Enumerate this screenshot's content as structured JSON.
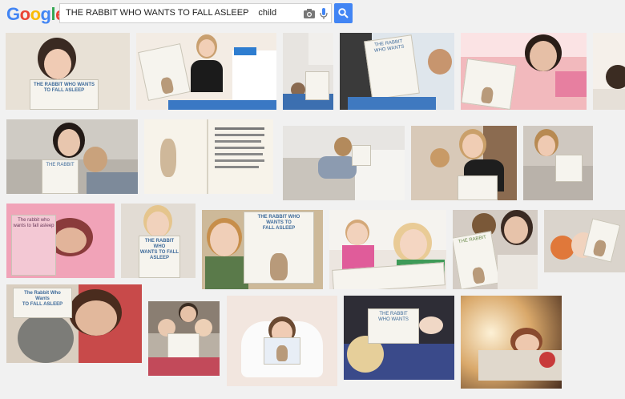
{
  "header": {
    "logo": "Google",
    "logo_colors": [
      "#4285f4",
      "#ea4335",
      "#fbbc05",
      "#4285f4",
      "#34a853",
      "#ea4335"
    ],
    "query": "THE RABBIT WHO WANTS TO FALL ASLEEP    child",
    "camera_icon": "camera-icon",
    "mic_icon": "microphone-icon",
    "search_icon": "search-icon",
    "search_button_color": "#4285f4"
  },
  "results": {
    "book_title_fragment": "THE RABBIT WHO WANTS TO FALL ASLEEP"
  }
}
